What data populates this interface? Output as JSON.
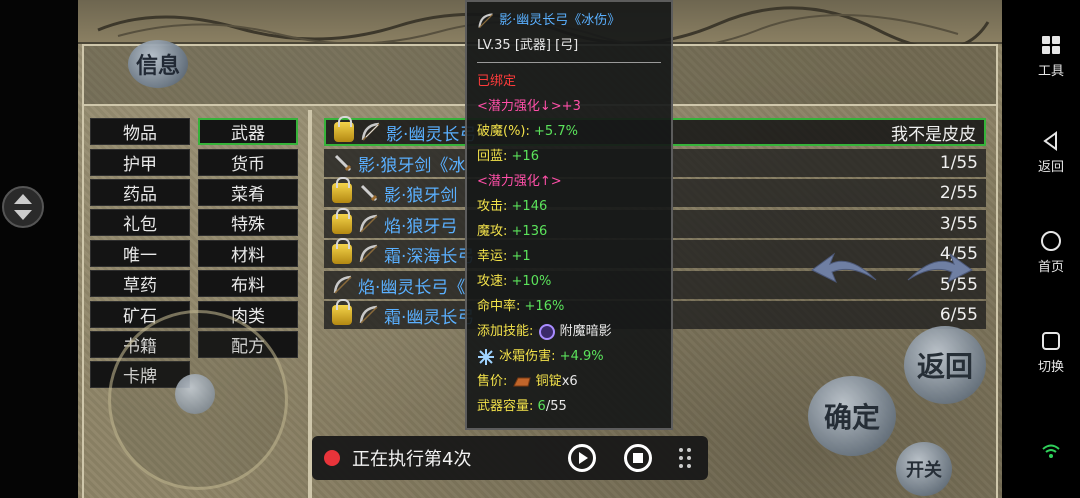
{
  "app": {
    "info_button": "信息",
    "back_button": "返回",
    "confirm_button": "确定",
    "toggle_button": "开关"
  },
  "categories": [
    {
      "label": "物品"
    },
    {
      "label": "武器"
    },
    {
      "label": "护甲"
    },
    {
      "label": "货币"
    },
    {
      "label": "药品"
    },
    {
      "label": "菜肴"
    },
    {
      "label": "礼包"
    },
    {
      "label": "特殊"
    },
    {
      "label": "唯一"
    },
    {
      "label": "材料"
    },
    {
      "label": "草药"
    },
    {
      "label": "布料"
    },
    {
      "label": "矿石"
    },
    {
      "label": "肉类"
    },
    {
      "label": "书籍"
    },
    {
      "label": "配方"
    },
    {
      "label": "卡牌"
    }
  ],
  "selected_category": "武器",
  "items": [
    {
      "name": "影·幽灵长弓",
      "count": "我不是皮皮",
      "locked": true,
      "icon": "bow-icon"
    },
    {
      "name": "影·狼牙剑《冰",
      "count": "1/55",
      "locked": false,
      "icon": "sword-icon"
    },
    {
      "name": "影·狼牙剑",
      "count": "2/55",
      "locked": true,
      "icon": "sword-icon"
    },
    {
      "name": "焰·狼牙弓",
      "count": "3/55",
      "locked": true,
      "icon": "bow-icon"
    },
    {
      "name": "霜·深海长弓",
      "count": "4/55",
      "locked": true,
      "icon": "bow-icon"
    },
    {
      "name": "焰·幽灵长弓《",
      "count": "5/55",
      "locked": false,
      "icon": "bow-icon"
    },
    {
      "name": "霜·幽灵长弓",
      "count": "6/55",
      "locked": true,
      "icon": "bow-icon"
    }
  ],
  "tooltip": {
    "title": "影·幽灵长弓《冰伤》",
    "level_line": "LV.35 [武器] [弓]",
    "bound": "已绑定",
    "potential_down": "<潜力强化↓>+3",
    "break_magic_label": "破魔(%):",
    "break_magic_value": "+5.7%",
    "mana_regen_label": "回蓝:",
    "mana_regen_value": "+16",
    "potential_up": "<潜力强化↑>",
    "attack_label": "攻击:",
    "attack_value": "+146",
    "magic_attack_label": "魔攻:",
    "magic_attack_value": "+136",
    "luck_label": "幸运:",
    "luck_value": "+1",
    "speed_label": "攻速:",
    "speed_value": "+10%",
    "hit_label": "命中率:",
    "hit_value": "+16%",
    "skill_label": "添加技能:",
    "skill_value": "附魔暗影",
    "frost_label": "冰霜伤害:",
    "frost_value": "+4.9%",
    "price_label": "售价:",
    "price_item": "铜锭",
    "price_qty": "x6",
    "capacity_label": "武器容量:",
    "capacity_current": "6",
    "capacity_total": "/55"
  },
  "recorder": {
    "status_text": "正在执行第4次"
  },
  "system_nav": {
    "tools": "工具",
    "back": "返回",
    "home": "首页",
    "switch": "切换"
  },
  "colors": {
    "selected_border": "#36b33a",
    "item_name": "#5ab0ff",
    "stat_value": "#5be35b",
    "stat_label": "#f2e14a",
    "bound_red": "#ff3b3b",
    "potential_pink": "#ff4fa8"
  }
}
